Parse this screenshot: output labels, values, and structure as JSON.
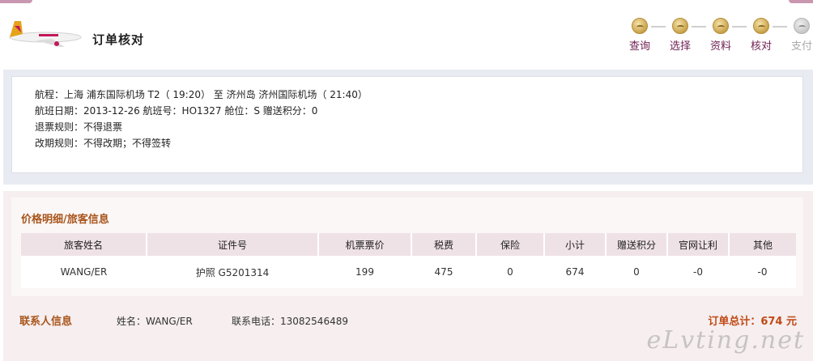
{
  "header": {
    "title": "订单核对",
    "steps": [
      {
        "label": "查询",
        "active": true
      },
      {
        "label": "选择",
        "active": true
      },
      {
        "label": "资料",
        "active": true
      },
      {
        "label": "核对",
        "active": true
      },
      {
        "label": "支付",
        "active": false
      }
    ]
  },
  "itinerary": {
    "route": "航程：上海 浦东国际机场 T2（ 19:20） 至 济州岛 济州国际机场（ 21:40）",
    "flight": "航班日期：2013-12-26 航班号：HO1327 舱位：S 赠送积分：0",
    "refund": "退票规则：不得退票",
    "change": "改期规则：不得改期；不得签转"
  },
  "price": {
    "section_title": "价格明细/旅客信息",
    "columns": [
      "旅客姓名",
      "证件号",
      "机票票价",
      "税费",
      "保险",
      "小计",
      "赠送积分",
      "官网让利",
      "其他"
    ],
    "rows": [
      [
        "WANG/ER",
        "护照 G5201314",
        "199",
        "475",
        "0",
        "674",
        "0",
        "-0",
        "-0"
      ]
    ]
  },
  "contact": {
    "title": "联系人信息",
    "name": "姓名：WANG/ER",
    "phone": "联系电话：13082546489",
    "total": "订单总计：674 元"
  },
  "watermark": "eLvting.net",
  "colors": {
    "accent": "#a8551b",
    "step_active": "#6d1f52",
    "step_inactive": "#aaaaaa",
    "table_header_bg": "#efe2e6",
    "panel_bg": "#f6eeef"
  }
}
